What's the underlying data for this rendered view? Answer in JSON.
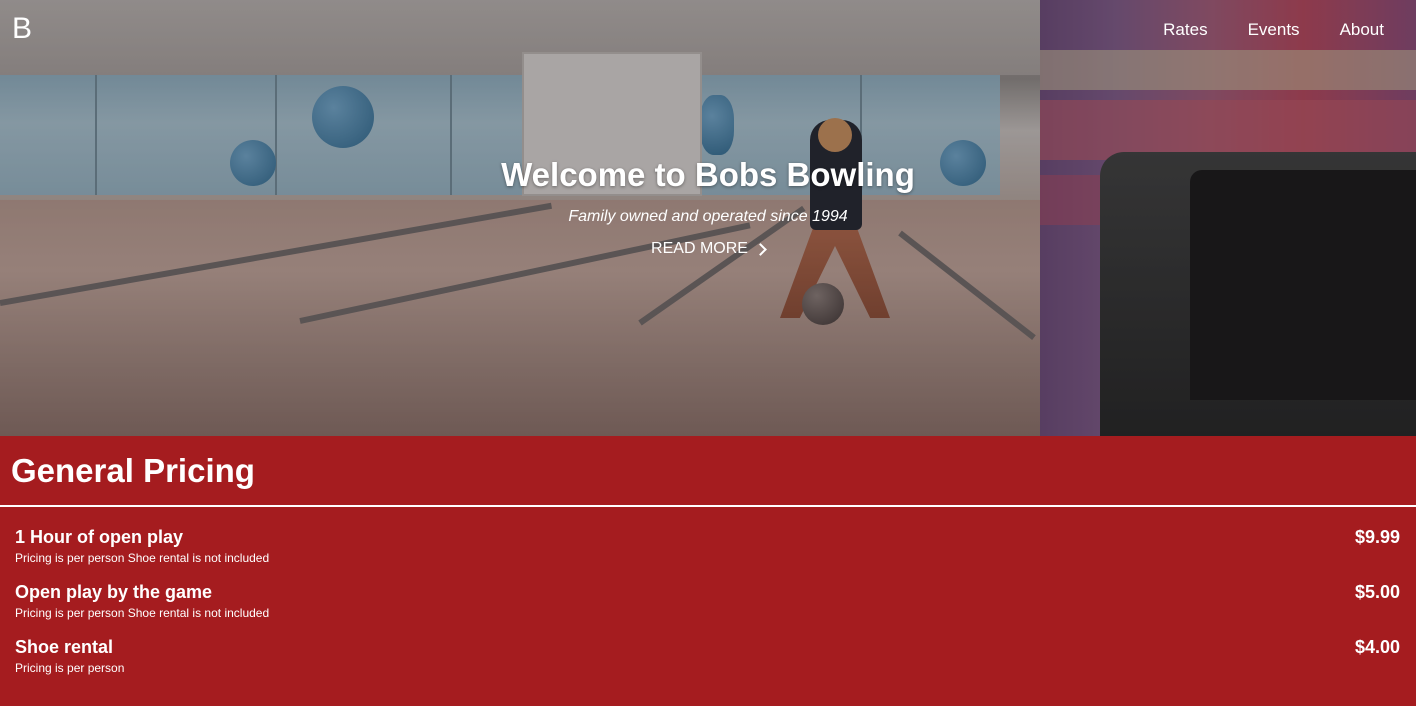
{
  "header": {
    "logo": "B",
    "nav": [
      "Rates",
      "Events",
      "About"
    ]
  },
  "hero": {
    "title": "Welcome to Bobs Bowling",
    "subtitle": "Family owned and operated since 1994",
    "cta": "READ MORE"
  },
  "pricing": {
    "heading": "General Pricing",
    "items": [
      {
        "title": "1 Hour of open play",
        "note": "Pricing is per person Shoe rental is not included",
        "price": "$9.99"
      },
      {
        "title": "Open play by the game",
        "note": "Pricing is per person Shoe rental is not included",
        "price": "$5.00"
      },
      {
        "title": "Shoe rental",
        "note": "Pricing is per person",
        "price": "$4.00"
      }
    ]
  },
  "colors": {
    "accent": "#a51c1f",
    "text": "#ffffff"
  }
}
